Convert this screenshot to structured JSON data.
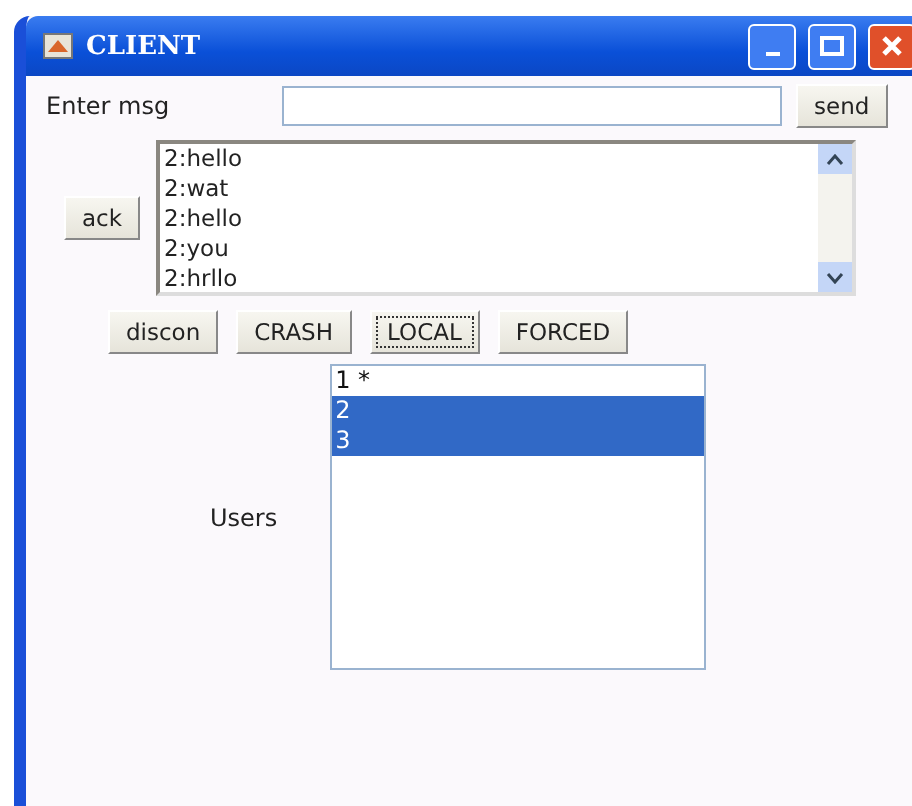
{
  "window": {
    "title": "CLIENT"
  },
  "message": {
    "label": "Enter msg",
    "send": "send"
  },
  "ack": "ack",
  "log": [
    "2:hello",
    "2:wat",
    "2:hello",
    "2:you",
    "2:hrllo"
  ],
  "buttons": [
    {
      "label": "discon",
      "focused": false
    },
    {
      "label": "CRASH",
      "focused": false
    },
    {
      "label": "LOCAL",
      "focused": true
    },
    {
      "label": "FORCED",
      "focused": false
    }
  ],
  "users": {
    "label": "Users",
    "items": [
      {
        "label": "1 *",
        "selected": false
      },
      {
        "label": "2",
        "selected": true
      },
      {
        "label": "3",
        "selected": true
      }
    ]
  }
}
